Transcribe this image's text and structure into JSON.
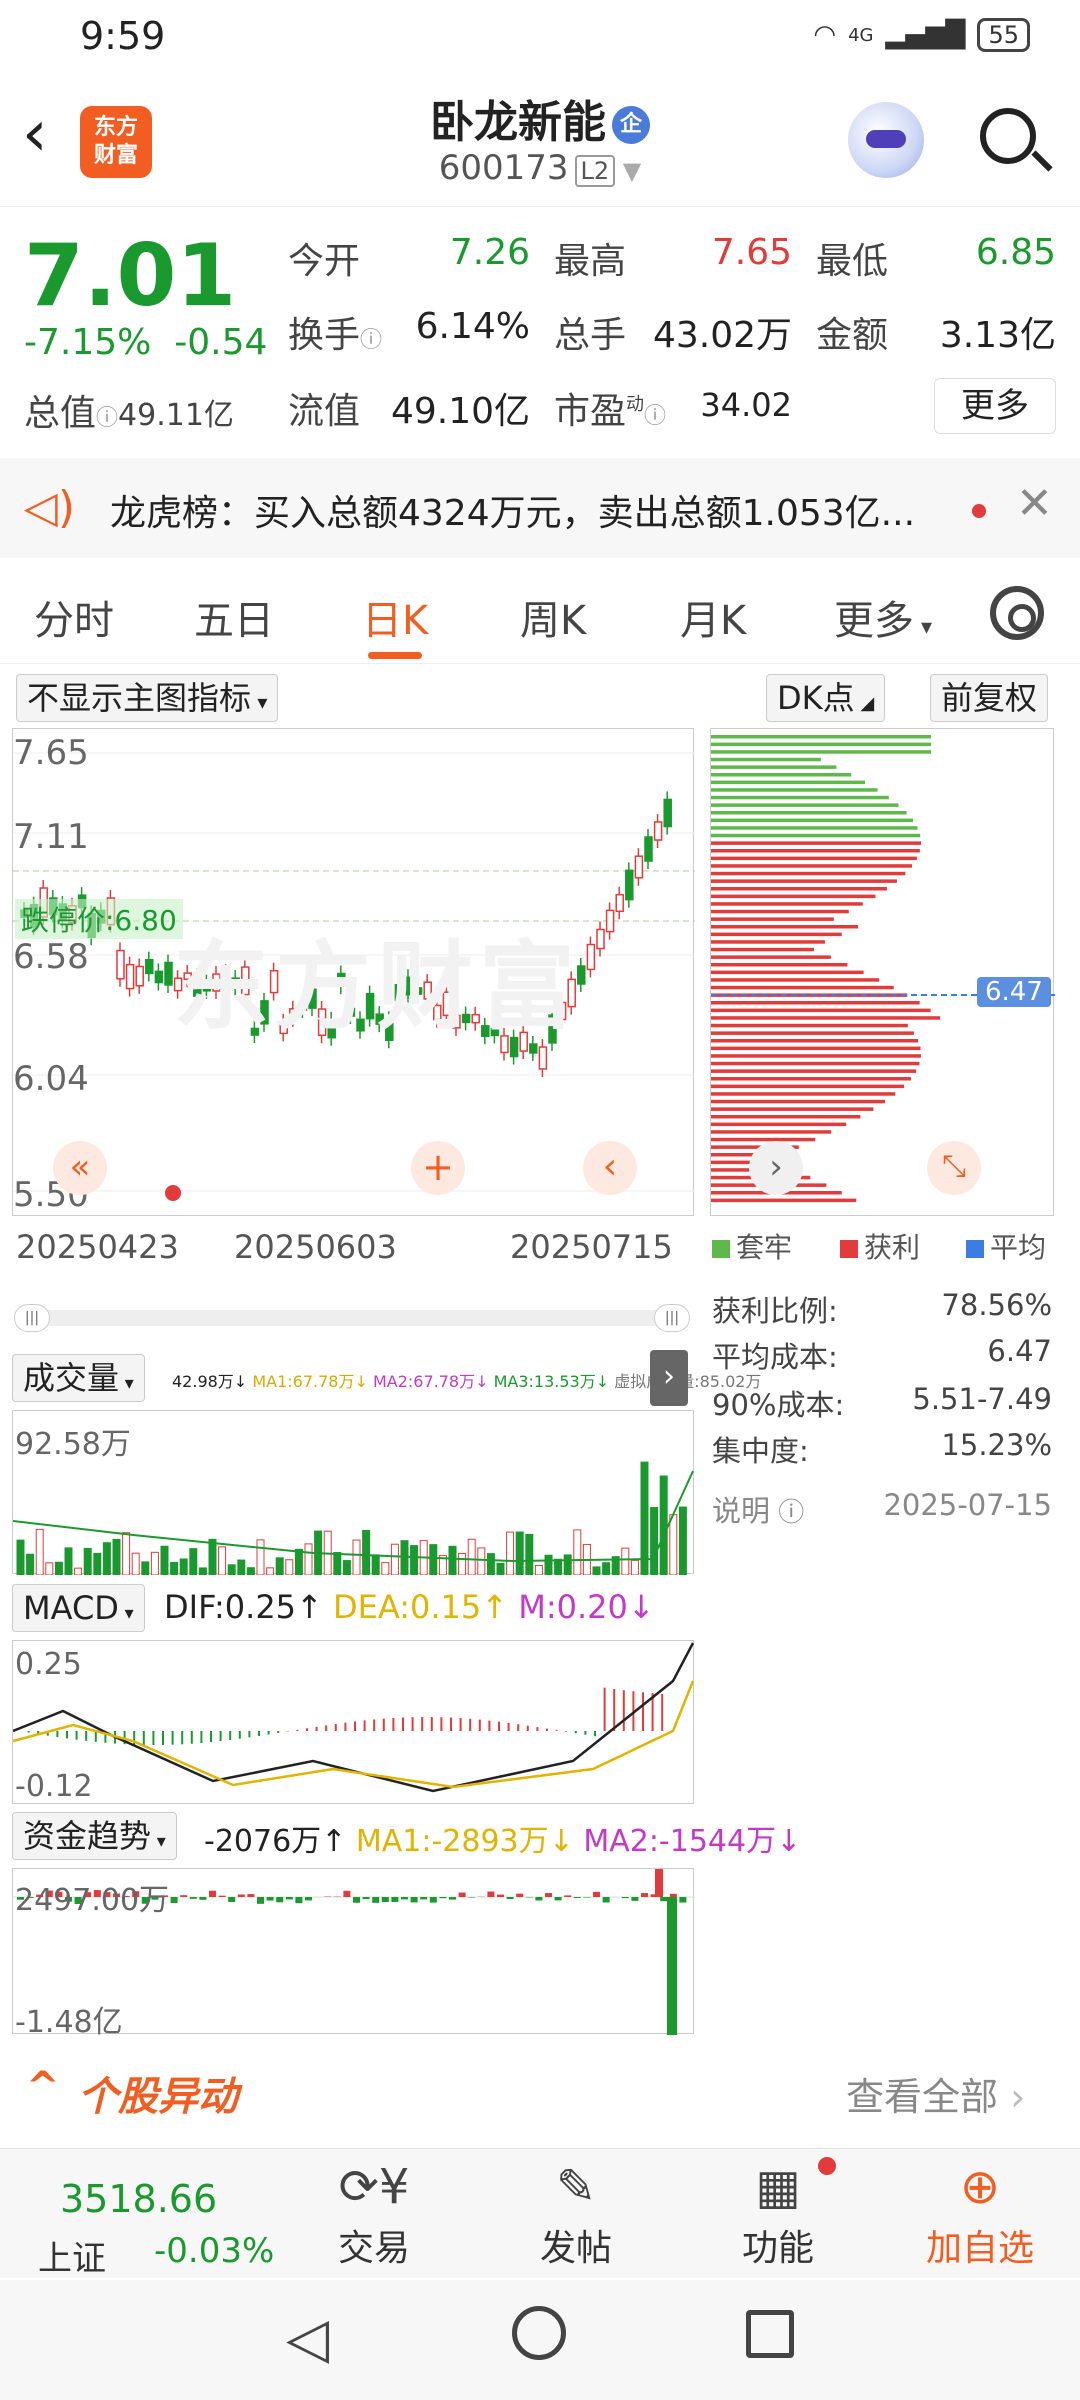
{
  "status": {
    "time": "9:59",
    "network": "4G",
    "battery": "55"
  },
  "header": {
    "back_icon": "chevron-left-icon",
    "logo_text_1": "东方",
    "logo_text_2": "财富",
    "stock_name": "卧龙新能",
    "enterprise_badge": "企",
    "stock_code": "600173",
    "level_badge": "L2"
  },
  "quote": {
    "price": "7.01",
    "change_pct": "-7.15%",
    "change_amt": "-0.54",
    "total_value_label": "总值",
    "total_value": "49.11亿",
    "open_label": "今开",
    "open": "7.26",
    "high_label": "最高",
    "high": "7.65",
    "low_label": "最低",
    "low": "6.85",
    "turnover_label": "换手",
    "turnover": "6.14%",
    "volume_label": "总手",
    "volume": "43.02万",
    "amount_label": "金额",
    "amount": "3.13亿",
    "float_value_label": "流值",
    "float_value": "49.10亿",
    "pe_label": "市盈",
    "pe_sup": "动",
    "pe": "34.02",
    "more_label": "更多"
  },
  "banner": {
    "text": "龙虎榜：买入总额4324万元，卖出总额1.053亿..."
  },
  "tabs": {
    "items": [
      "分时",
      "五日",
      "日K",
      "周K",
      "月K",
      "更多"
    ],
    "active": "日K"
  },
  "kline": {
    "indicator_select": "不显示主图指标",
    "dk_label": "DK点",
    "adjust_label": "前复权",
    "y_labels": [
      "7.65",
      "7.11",
      "6.58",
      "6.04",
      "5.50"
    ],
    "limit_label": "跌停价:6.80",
    "x_labels": [
      "20250423",
      "20250603",
      "20250715"
    ],
    "watermark": "东方财富"
  },
  "chip": {
    "legend": [
      "套牢",
      "获利",
      "平均"
    ],
    "avg_price_tag": "6.47",
    "stats": [
      {
        "label": "获利比例:",
        "value": "78.56%"
      },
      {
        "label": "平均成本:",
        "value": "6.47"
      },
      {
        "label": "90%成本:",
        "value": "5.51-7.49"
      },
      {
        "label": "集中度:",
        "value": "15.23%"
      }
    ],
    "note_label": "说明",
    "date": "2025-07-15"
  },
  "volume": {
    "select": "成交量",
    "legend": "42.98万↓",
    "ma1": "MA1:67.78万↓",
    "ma2": "MA2:67.78万↓",
    "ma3": "MA3:13.53万↓",
    "virtual": "虚拟成交量:85.02万",
    "top_label": "92.58万"
  },
  "macd": {
    "select": "MACD",
    "dif": "DIF:0.25↑",
    "dea": "DEA:0.15↑",
    "m": "M:0.20↓",
    "top": "0.25",
    "bottom": "-0.12"
  },
  "fund": {
    "select": "资金趋势",
    "val": "-2076万↑",
    "ma1": "MA1:-2893万↓",
    "ma2": "MA2:-1544万↓",
    "top": "2497.00万",
    "bottom": "-1.48亿"
  },
  "yidong": {
    "title": "个股异动",
    "link": "查看全部"
  },
  "tabbar": {
    "index_value": "3518.66",
    "index_name": "上证",
    "index_change": "-0.03%",
    "items": [
      "交易",
      "发帖",
      "功能",
      "加自选"
    ]
  },
  "colors": {
    "up": "#e23b3b",
    "down": "#1a9a2e",
    "accent": "#f25e22"
  }
}
